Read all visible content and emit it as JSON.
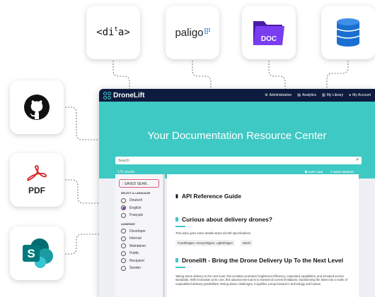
{
  "tiles": {
    "dita_label": "<di",
    "dita_label2": "a>",
    "paligo_label": "paligo",
    "doc_label": "DOC",
    "pdf_label": "PDF"
  },
  "app": {
    "brand": "DroneLift",
    "nav": [
      "Administration",
      "Analytics",
      "My Library",
      "My Account"
    ],
    "hero_title": "Your Documentation Resource Center",
    "search_placeholder": "Search",
    "results_count": "176 results",
    "copy_link": "COPY LINK",
    "save_search": "SAVE SEARCH",
    "saved_searches": "SAVED SEAR..",
    "language_group": "SELECT A LANGUAGE",
    "languages": [
      "Deutsch",
      "English",
      "Français"
    ],
    "selected_language": "English",
    "audience_group": "AUDIENCE",
    "audiences": [
      "Developer",
      "Internal",
      "Maintainer",
      "Public",
      "Recipient",
      "Sender"
    ],
    "results": [
      {
        "title": "API Reference Guide"
      },
      {
        "title": "Curious about delivery drones?",
        "desc": "This video goes some details about aircraft specifications.",
        "tags": [
          "FoodShipper, HeavyShipper, LightShipper",
          "World"
        ]
      },
      {
        "title": "Dronelift - Bring the Drone Delivery Up To the Next Level",
        "desc": "Taking drone delivery to the next level, this evolution promises heightened efficiency, expanded capabilities, and elevated service standards. With innovation at its core, this advancement aims to transcend current limitations, transforming the skies into a realm of unparalleled delivery possibilities. Rising above challenges, it signifies a leap forward in technology and human"
      }
    ]
  },
  "colors": {
    "teal": "#3ec9c4",
    "navy": "#0d1b3e",
    "pdf_red": "#d6262b",
    "doc_purple": "#6a2bd9",
    "db_blue": "#1b6fd1",
    "sharepoint_teal": "#0b7a75"
  }
}
